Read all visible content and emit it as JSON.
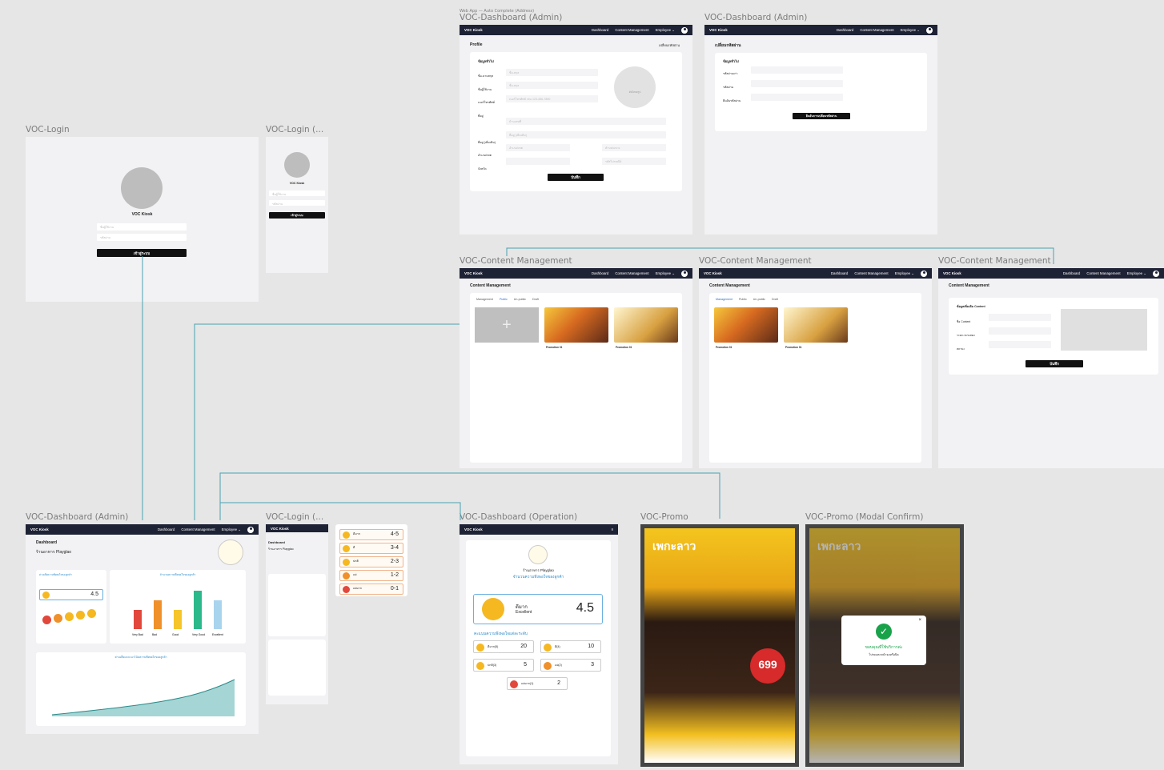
{
  "canvas_header": "Web App — Auto Complete (Address)",
  "frames": {
    "login": "VOC-Login",
    "login_mobile": "VOC-Login (...",
    "dash_admin": "VOC-Dashboard (Admin)",
    "cm": "VOC-Content Management",
    "dash_op": "VOC-Dashboard (Operation)",
    "promo": "VOC-Promo",
    "promo_modal": "VOC-Promo (Modal Confirm)"
  },
  "nav": {
    "brand": "VOC Kiosk",
    "dashboard": "Dashboard",
    "content": "Content Management",
    "employee": "Employee ⌄",
    "admin": "ADM"
  },
  "login": {
    "title": "VOC Kiosk",
    "username_ph": "ชื่อผู้ใช้งาน",
    "password_ph": "รหัสผ่าน",
    "show": "Show",
    "submit": "เข้าสู่ระบบ"
  },
  "profile": {
    "title": "Profile",
    "change_pw": "เปลี่ยนรหัสผ่าน",
    "section": "ข้อมูลทั่วไป",
    "fields": [
      "ชื่อ-นามสกุล",
      "ชื่อผู้ใช้งาน",
      "เบอร์โทรศัพท์",
      "ที่อยู่",
      "ที่อยู่ (เพิ่มเติม)",
      "อำเภอ/เขต",
      "จังหวัด"
    ],
    "placeholders": [
      "ชื่อ-สกุล",
      "ชื่อ-สกุล",
      "เบอร์โทรศัพท์ เช่น 123-456-7890",
      "",
      "บ้านเลขที่",
      "ที่อยู่ (เพิ่มเติม)",
      "อำเภอ/เขต"
    ],
    "upload": "อัพโหลดรูป",
    "save": "บันทึก",
    "tambon": "ตำบล/แขวง",
    "zipcode": "รหัสไปรษณีย์"
  },
  "password": {
    "title": "เปลี่ยนรหัสผ่าน",
    "section": "ข้อมูลทั่วไป",
    "fields": [
      "รหัสผ่านเก่า",
      "รหัสผ่าน",
      "ยืนยันรหัสผ่าน"
    ],
    "show": "Show",
    "confirm": "ยืนยันการเปลี่ยนรหัสผ่าน"
  },
  "cm": {
    "title": "Content Management",
    "tabs": [
      "Management",
      "Public",
      "Un-public",
      "Draft"
    ],
    "card1": "Promotion 01",
    "card2": "Promotion 01",
    "card3": "Promotion 01",
    "form_title": "ข้อมูลเพิ่มเติม Content",
    "form_fields": [
      "ชื่อ Content",
      "ระยะเวลาแสดง",
      "สถานะ"
    ],
    "save": "บันทึก"
  },
  "dash": {
    "title": "Dashboard",
    "store": "ร้านอาหาร Playglao",
    "filters": [
      "VOC",
      "Feedback",
      "Profile",
      "VSP"
    ],
    "date": "01/06/2025 - 11/06/2025",
    "chart1_title": "ค่าเฉลี่ยความพึงพอใจของลูกค้า",
    "chart1_sub": "(Avg. Voice of Customer – VOC)",
    "score": "4.5",
    "score_label": "Excellent",
    "chart2_title": "จำนวนความพึงพอใจของลูกค้า",
    "chart2_sub": "(Voice of Customer – VOC)",
    "chart3_title": "ค่าเฉลี่ยและแนวโน้มความพึงพอใจของลูกค้า",
    "chart3_sub": "(Avg. Voice of Customer – VOC)"
  },
  "chart_data": {
    "type": "bar",
    "categories": [
      "Very Bad",
      "Bad",
      "Good",
      "Very Good",
      "Excellent"
    ],
    "values": [
      2,
      3,
      2,
      4,
      3
    ],
    "ylim": [
      0,
      5
    ]
  },
  "legend": [
    {
      "label": "ดีมาก",
      "range": "4-5",
      "sub": "Excellent"
    },
    {
      "label": "ดี",
      "range": "3-4",
      "sub": "Very Good"
    },
    {
      "label": "ปกติ",
      "range": "2-3",
      "sub": "Good"
    },
    {
      "label": "แย่",
      "range": "1-2",
      "sub": "Bad"
    },
    {
      "label": "แย่มาก",
      "range": "0-1",
      "sub": "Very Bad"
    }
  ],
  "op": {
    "store": "ร้านอาหาร Playglao",
    "title": "จำนวนความพึงพอใจของลูกค้า",
    "sub": "(Voice of Customer – VOC)",
    "label": "ดีมาก",
    "label_en": "Excellent",
    "score": "4.5",
    "section": "คะแนนความพึงพอใจแต่ละระดับ",
    "levels": [
      {
        "label": "ดีมาก(5)",
        "en": "Excellent",
        "count": "20"
      },
      {
        "label": "ดี(4)",
        "en": "Very Good",
        "count": "10"
      },
      {
        "label": "ปกติ(3)",
        "en": "Good",
        "count": "5"
      },
      {
        "label": "แย่(2)",
        "en": "Bad",
        "count": "3"
      },
      {
        "label": "แย่มาก(1)",
        "en": "Very Bad",
        "count": "2"
      }
    ]
  },
  "promo": {
    "banner": "เพกะลาว",
    "price": "699",
    "modal_title": "ขอบคุณที่ใช้บริการค่ะ",
    "modal_sub": "โปรดแตะหน้าจอหรือปิด"
  }
}
